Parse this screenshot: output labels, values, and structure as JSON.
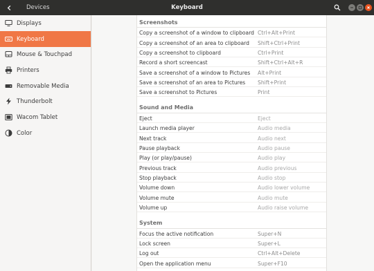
{
  "window": {
    "sidebar_title": "Devices",
    "title": "Keyboard",
    "icons": [
      "back-icon",
      "search-icon",
      "minimize-icon",
      "maximize-icon",
      "close-icon"
    ],
    "accent": "#f07746",
    "close_color": "#e95420"
  },
  "sidebar": {
    "items": [
      {
        "label": "Displays",
        "icon": "display-icon"
      },
      {
        "label": "Keyboard",
        "icon": "keyboard-icon",
        "active": true
      },
      {
        "label": "Mouse & Touchpad",
        "icon": "mouse-icon"
      },
      {
        "label": "Printers",
        "icon": "printer-icon"
      },
      {
        "label": "Removable Media",
        "icon": "removable-media-icon"
      },
      {
        "label": "Thunderbolt",
        "icon": "thunderbolt-icon"
      },
      {
        "label": "Wacom Tablet",
        "icon": "tablet-icon"
      },
      {
        "label": "Color",
        "icon": "color-icon"
      }
    ]
  },
  "sections": [
    {
      "title": "Screenshots",
      "rows": [
        {
          "action": "Copy a screenshot of a window to clipboard",
          "accel": "Ctrl+Alt+Print"
        },
        {
          "action": "Copy a screenshot of an area to clipboard",
          "accel": "Shift+Ctrl+Print"
        },
        {
          "action": "Copy a screenshot to clipboard",
          "accel": "Ctrl+Print"
        },
        {
          "action": "Record a short screencast",
          "accel": "Shift+Ctrl+Alt+R"
        },
        {
          "action": "Save a screenshot of a window to Pictures",
          "accel": "Alt+Print"
        },
        {
          "action": "Save a screenshot of an area to Pictures",
          "accel": "Shift+Print"
        },
        {
          "action": "Save a screenshot to Pictures",
          "accel": "Print"
        }
      ]
    },
    {
      "title": "Sound and Media",
      "rows": [
        {
          "action": "Eject",
          "accel": "Eject"
        },
        {
          "action": "Launch media player",
          "accel": "Audio media"
        },
        {
          "action": "Next track",
          "accel": "Audio next"
        },
        {
          "action": "Pause playback",
          "accel": "Audio pause"
        },
        {
          "action": "Play (or play/pause)",
          "accel": "Audio play"
        },
        {
          "action": "Previous track",
          "accel": "Audio previous"
        },
        {
          "action": "Stop playback",
          "accel": "Audio stop"
        },
        {
          "action": "Volume down",
          "accel": "Audio lower volume"
        },
        {
          "action": "Volume mute",
          "accel": "Audio mute"
        },
        {
          "action": "Volume up",
          "accel": "Audio raise volume"
        }
      ]
    },
    {
      "title": "System",
      "rows": [
        {
          "action": "Focus the active notification",
          "accel": "Super+N"
        },
        {
          "action": "Lock screen",
          "accel": "Super+L"
        },
        {
          "action": "Log out",
          "accel": "Ctrl+Alt+Delete"
        },
        {
          "action": "Open the application menu",
          "accel": "Super+F10"
        }
      ]
    }
  ]
}
